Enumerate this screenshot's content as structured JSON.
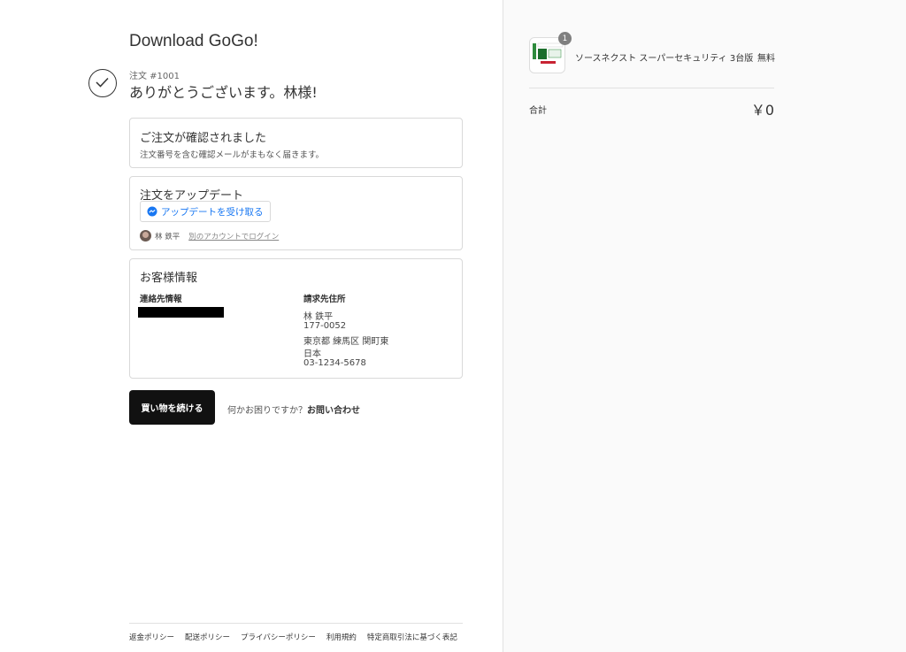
{
  "shop": {
    "name": "Download GoGo!"
  },
  "order": {
    "number_label": "注文 #1001",
    "thanks": "ありがとうございます。林様!"
  },
  "confirm_card": {
    "title": "ご注文が確認されました",
    "text": "注文番号を含む確認メールがまもなく届きます。"
  },
  "update_card": {
    "title": "注文をアップデート",
    "messenger_button": "アップデートを受け取る",
    "user_name": "林 鉄平",
    "switch_account": "別のアカウントでログイン"
  },
  "customer_card": {
    "title": "お客様情報",
    "contact_heading": "連絡先情報",
    "billing_heading": "請求先住所",
    "billing_lines": [
      "林 鉄平",
      "177-0052",
      "東京都 練馬区 関町東",
      "日本",
      "03-1234-5678"
    ]
  },
  "actions": {
    "continue_shopping": "買い物を続ける",
    "help_prefix": "何かお困りですか？",
    "contact_link": "お問い合わせ"
  },
  "footer": {
    "links": [
      "返金ポリシー",
      "配送ポリシー",
      "プライバシーポリシー",
      "利用規約",
      "特定商取引法に基づく表記"
    ]
  },
  "summary": {
    "item": {
      "quantity": "1",
      "name": "ソースネクスト スーパーセキュリティ 3台版",
      "price": "無料"
    },
    "total_label": "合計",
    "total_value": "￥0"
  },
  "colors": {
    "accent": "#1877f2",
    "button": "#111111",
    "sidebar_bg": "#fafafa"
  }
}
